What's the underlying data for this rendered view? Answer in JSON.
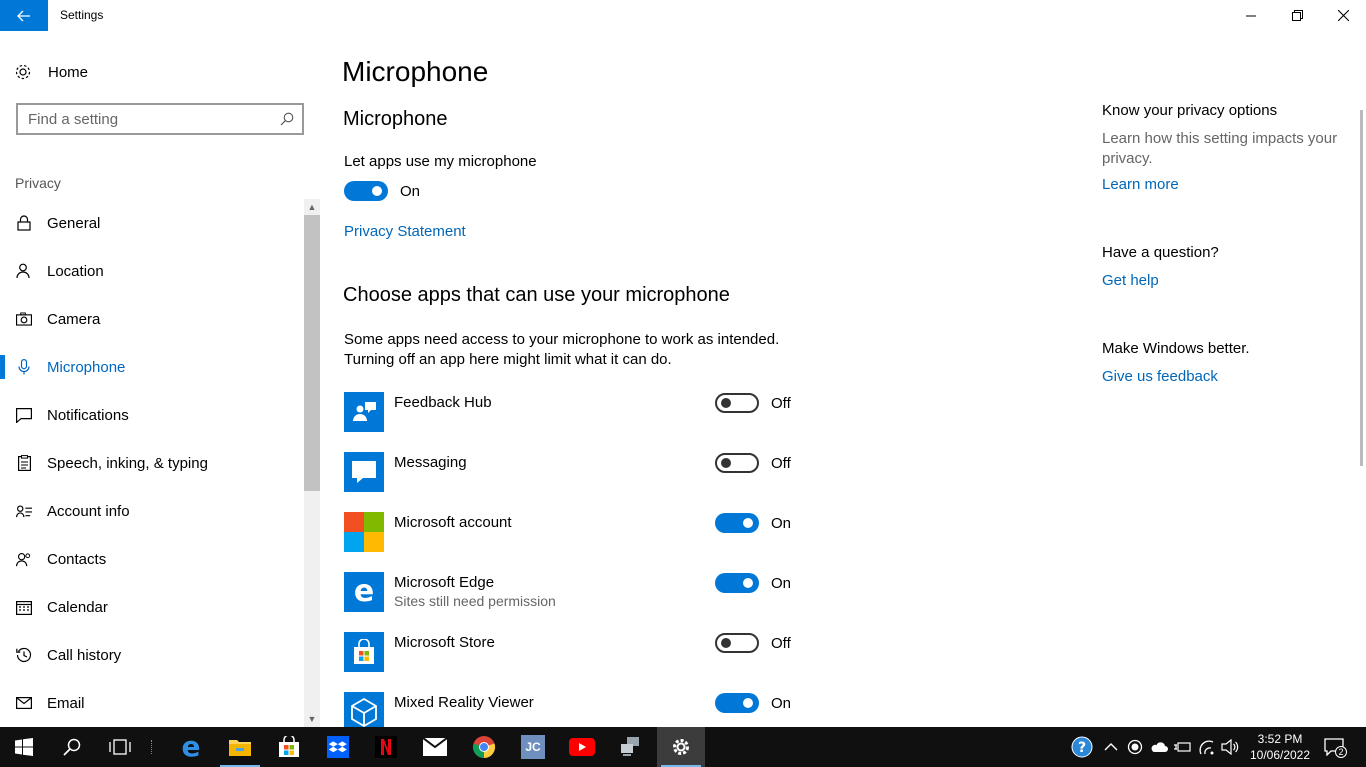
{
  "window": {
    "title": "Settings",
    "controls": {
      "minimize": "minimize",
      "maximize": "restore",
      "close": "close"
    }
  },
  "sidebar": {
    "home_label": "Home",
    "search_placeholder": "Find a setting",
    "section_label": "Privacy",
    "items": [
      {
        "label": "General",
        "icon": "lock-icon"
      },
      {
        "label": "Location",
        "icon": "person-location-icon"
      },
      {
        "label": "Camera",
        "icon": "camera-icon"
      },
      {
        "label": "Microphone",
        "icon": "microphone-icon",
        "active": true
      },
      {
        "label": "Notifications",
        "icon": "notification-icon"
      },
      {
        "label": "Speech, inking, & typing",
        "icon": "clipboard-icon"
      },
      {
        "label": "Account info",
        "icon": "account-info-icon"
      },
      {
        "label": "Contacts",
        "icon": "contacts-icon"
      },
      {
        "label": "Calendar",
        "icon": "calendar-icon"
      },
      {
        "label": "Call history",
        "icon": "history-icon"
      },
      {
        "label": "Email",
        "icon": "email-icon"
      }
    ]
  },
  "main": {
    "page_title": "Microphone",
    "section1_title": "Microphone",
    "master_toggle_label": "Let apps use my microphone",
    "master_toggle_state": "On",
    "privacy_link": "Privacy Statement",
    "section2_title": "Choose apps that can use your microphone",
    "section2_desc_line1": "Some apps need access to your microphone to work as intended.",
    "section2_desc_line2": "Turning off an app here might limit what it can do.",
    "apps": [
      {
        "name": "Feedback Hub",
        "sub": "",
        "state": "Off",
        "icon": "feedback-hub-icon"
      },
      {
        "name": "Messaging",
        "sub": "",
        "state": "Off",
        "icon": "messaging-icon"
      },
      {
        "name": "Microsoft account",
        "sub": "",
        "state": "On",
        "icon": "microsoft-logo-icon"
      },
      {
        "name": "Microsoft Edge",
        "sub": "Sites still need permission",
        "state": "On",
        "icon": "edge-icon"
      },
      {
        "name": "Microsoft Store",
        "sub": "",
        "state": "Off",
        "icon": "store-icon"
      },
      {
        "name": "Mixed Reality Viewer",
        "sub": "",
        "state": "On",
        "icon": "mixed-reality-icon"
      }
    ]
  },
  "right": {
    "privacy_head": "Know your privacy options",
    "privacy_text": "Learn how this setting impacts your privacy.",
    "learn_more": "Learn more",
    "question_head": "Have a question?",
    "get_help": "Get help",
    "better_head": "Make Windows better.",
    "feedback_link": "Give us feedback"
  },
  "taskbar": {
    "time": "3:52 PM",
    "date": "10/06/2022",
    "notification_count": "2",
    "pinned": [
      "start-icon",
      "search-icon",
      "task-view-icon",
      "edge-icon",
      "file-explorer-icon",
      "store-icon",
      "dropbox-icon",
      "netflix-icon",
      "mail-icon",
      "chrome-icon",
      "jc-app-icon",
      "youtube-icon",
      "network-tool-icon",
      "settings-icon"
    ]
  },
  "colors": {
    "accent": "#0078d7",
    "link": "#0067b8",
    "taskbar": "#101010"
  }
}
